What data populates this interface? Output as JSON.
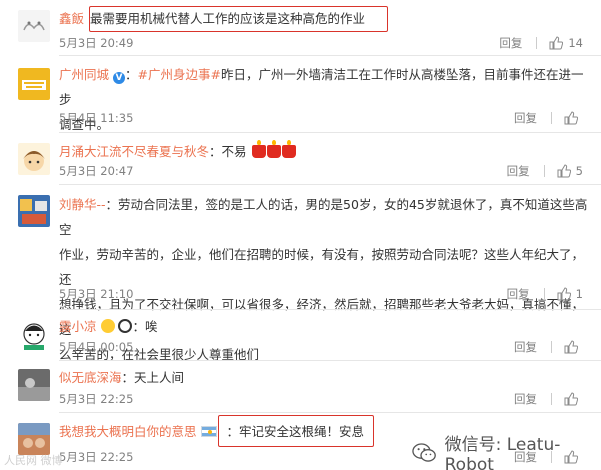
{
  "comments": [
    {
      "user": "鑫飯",
      "text": "最需要用机械代替人工作的应该是这种高危的作业",
      "time": "5月3日 20:49",
      "reply": "回复",
      "likes": "14"
    },
    {
      "user": "广州同城",
      "verified": "V",
      "topic": "#广州身边事#",
      "text_line1": "昨日，广州一外墙清洁工在工作时从高楼坠落，目前事件还在进一步",
      "text_line2": "调查中。",
      "time": "5月4日 11:35",
      "reply": "回复",
      "likes": ""
    },
    {
      "user": "月涌大江流不尽春夏与秋冬",
      "text": "：不易",
      "time": "5月3日 20:47",
      "reply": "回复",
      "likes": "5"
    },
    {
      "user": "刘静华--",
      "text_lines": [
        "：劳动合同法里，签的是工人的话，男的是50岁，女的45岁就退休了，真不知道这些高空",
        "作业，劳动辛苦的，企业，他们在招聘的时候，有没有，按照劳动合同法呢？这些人年纪大了，还",
        "想挣钱，且为了不交社保啊，可以省很多，经济，然后就，招聘那些老大爷老大妈，真搞不懂，这",
        "么辛苦的，在社会里很少人尊重他们"
      ],
      "time": "5月3日 21:10",
      "reply": "回复",
      "likes": "1"
    },
    {
      "user": "露小凉",
      "text": "：唉",
      "time": "5月4日 00:05",
      "reply": "回复",
      "likes": ""
    },
    {
      "user": "似无底深海",
      "text": "：天上人间",
      "time": "5月3日 22:25",
      "reply": "回复",
      "likes": ""
    },
    {
      "user": "我想我大概明白你的意思",
      "text": "牢记安全这根绳！安息",
      "time": "5月3日 22:25",
      "reply": "回复",
      "likes": ""
    }
  ],
  "watermark": {
    "label": "微信号: Leatu-Robot",
    "icon": "wechat-icon"
  },
  "corner_watermark": "人民网 微博",
  "colors": {
    "username": "#eb7350",
    "highlight_box": "#d9342b",
    "meta_text": "#808080"
  }
}
